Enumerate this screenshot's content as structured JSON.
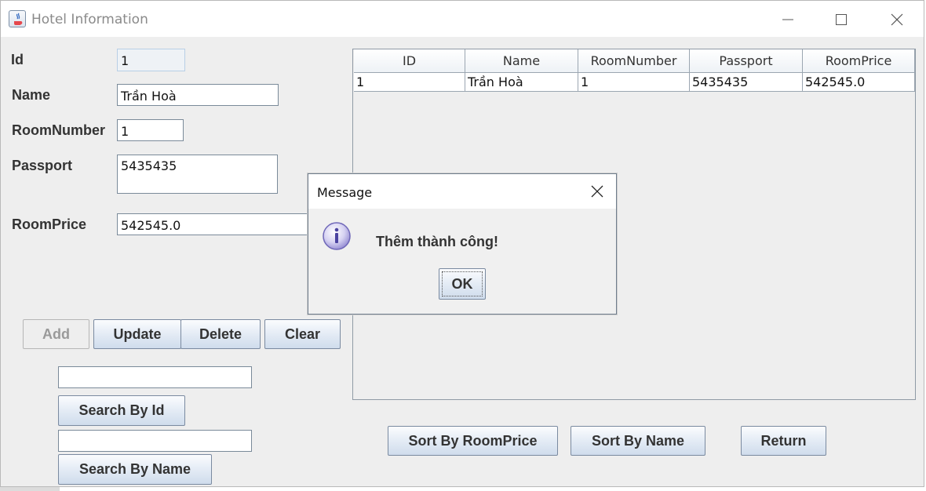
{
  "window": {
    "title": "Hotel Information",
    "controls": [
      "minimize-icon",
      "maximize-icon",
      "close-icon"
    ]
  },
  "form": {
    "id": {
      "label": "Id",
      "value": "1"
    },
    "name": {
      "label": "Name",
      "value": "Trần Hoà"
    },
    "room_number": {
      "label": "RoomNumber",
      "value": "1"
    },
    "passport": {
      "label": "Passport",
      "value": "5435435"
    },
    "room_price": {
      "label": "RoomPrice",
      "value": "542545.0"
    }
  },
  "actions": {
    "add": "Add",
    "update": "Update",
    "delete": "Delete",
    "clear": "Clear"
  },
  "search": {
    "id_value": "",
    "by_id": "Search By Id",
    "name_value": "",
    "by_name": "Search By Name"
  },
  "table": {
    "columns": [
      "ID",
      "Name",
      "RoomNumber",
      "Passport",
      "RoomPrice"
    ],
    "rows": [
      [
        "1",
        "Trần Hoà",
        "1",
        "5435435",
        "542545.0"
      ]
    ]
  },
  "sort": {
    "by_price": "Sort By RoomPrice",
    "by_name": "Sort By Name",
    "return": "Return"
  },
  "dialog": {
    "title": "Message",
    "icon": "info-icon",
    "message": "Thêm thành công!",
    "ok": "OK"
  },
  "colors": {
    "window_bg": "#eeeeee",
    "button_gradient_top": "#fbfcfe",
    "button_gradient_bottom": "#cfdcec",
    "border": "#7a8a99"
  }
}
